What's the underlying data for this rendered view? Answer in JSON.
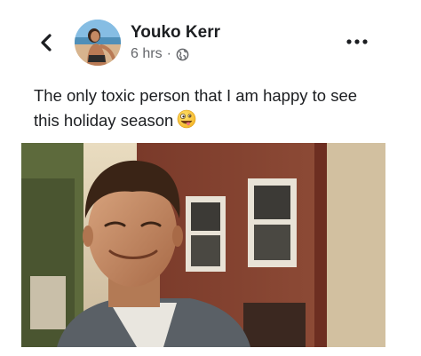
{
  "post": {
    "author": "Youko Kerr",
    "time": "6 hrs",
    "separator": "·",
    "text_line1": "The only toxic person that I am happy to see",
    "text_line2": "this holiday season"
  },
  "icons": {
    "back": "chevron-left-icon",
    "privacy": "globe-icon",
    "more": "more-horizontal-icon",
    "emoji": "zany-face-emoji"
  },
  "colors": {
    "text": "#1c1e21",
    "meta": "#65676b",
    "brick": "#8b3c2c"
  }
}
